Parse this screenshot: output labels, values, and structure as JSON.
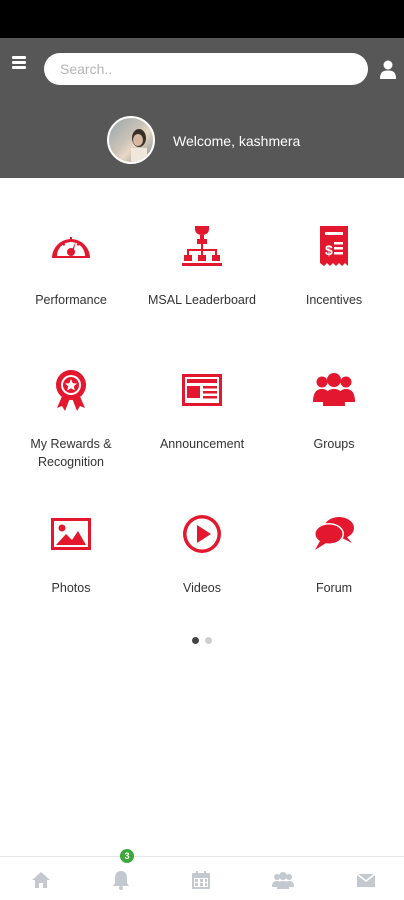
{
  "header": {
    "search_placeholder": "Search..",
    "welcome": "Welcome, kashmera"
  },
  "accent_color": "#e3172d",
  "tiles": [
    {
      "label": "Performance",
      "icon": "speedometer-icon"
    },
    {
      "label": "MSAL Leaderboard",
      "icon": "leaderboard-icon"
    },
    {
      "label": "Incentives",
      "icon": "receipt-icon"
    },
    {
      "label": "My Rewards & Recognition",
      "icon": "award-ribbon-icon"
    },
    {
      "label": "Announcement",
      "icon": "newspaper-icon"
    },
    {
      "label": "Groups",
      "icon": "groups-icon"
    },
    {
      "label": "Photos",
      "icon": "photo-icon"
    },
    {
      "label": "Videos",
      "icon": "play-circle-icon"
    },
    {
      "label": "Forum",
      "icon": "chat-bubbles-icon"
    }
  ],
  "pager": {
    "pages": 2,
    "current": 1
  },
  "bottom_nav": {
    "items": [
      "home-icon",
      "bell-icon",
      "calendar-icon",
      "group-icon",
      "mail-icon"
    ],
    "notification_count": "3"
  }
}
